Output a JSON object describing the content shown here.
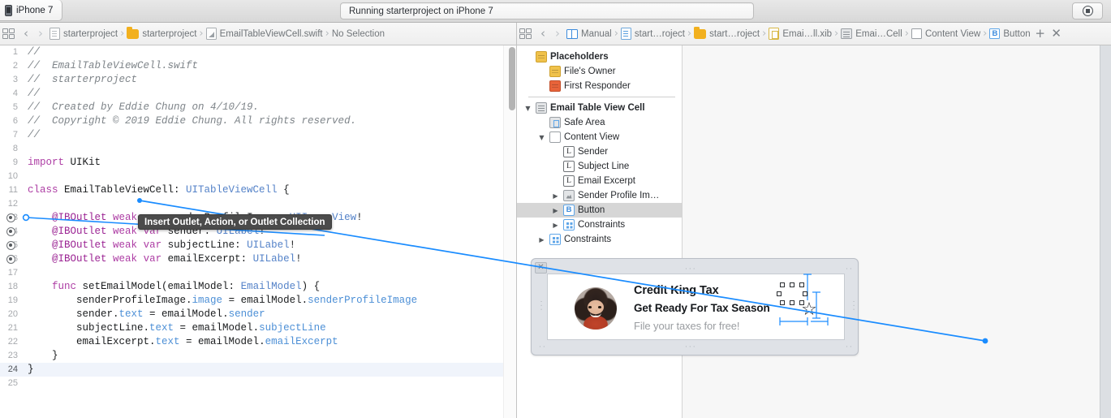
{
  "toolbar": {
    "scheme_tab": "iPhone 7",
    "device_icon": "iphone-icon",
    "activity_status": "Running starterproject on iPhone 7",
    "stop_button_label": "",
    "stop_icon": "stop-icon"
  },
  "left_jumpbar": {
    "related_items_icon": "related-items-icon",
    "back_arrow": "‹",
    "forward_arrow": "›",
    "crumbs": [
      {
        "label": "starterproject",
        "icon": "project-file-icon"
      },
      {
        "label": "starterproject",
        "icon": "folder-icon"
      },
      {
        "label": "EmailTableViewCell.swift",
        "icon": "swift-file-icon"
      },
      {
        "label": "No Selection",
        "icon": "none"
      }
    ],
    "separator": "›"
  },
  "right_jumpbar": {
    "related_items_icon": "related-items-icon",
    "back_arrow": "‹",
    "forward_arrow": "›",
    "crumbs": [
      {
        "label": "Manual",
        "icon": "assistant-manual-icon"
      },
      {
        "label": "start…roject",
        "icon": "project-doc-icon"
      },
      {
        "label": "start…roject",
        "icon": "folder-icon"
      },
      {
        "label": "Emai…ll.xib",
        "icon": "xib-file-icon"
      },
      {
        "label": "Emai…Cell",
        "icon": "table-view-cell-icon"
      },
      {
        "label": "Content View",
        "icon": "view-icon"
      },
      {
        "label": "Button",
        "icon": "button-icon"
      }
    ],
    "separator": "›",
    "add_editor": "+",
    "close_editor": "✕"
  },
  "editor": {
    "tooltip": "Insert Outlet, Action, or Outlet Collection",
    "current_line": 24,
    "lines": [
      {
        "n": "1",
        "gutter": "",
        "tokens": [
          {
            "t": "//",
            "c": "cmt"
          }
        ]
      },
      {
        "n": "2",
        "gutter": "",
        "tokens": [
          {
            "t": "//  EmailTableViewCell.swift",
            "c": "cmt"
          }
        ]
      },
      {
        "n": "3",
        "gutter": "",
        "tokens": [
          {
            "t": "//  starterproject",
            "c": "cmt"
          }
        ]
      },
      {
        "n": "4",
        "gutter": "",
        "tokens": [
          {
            "t": "//",
            "c": "cmt"
          }
        ]
      },
      {
        "n": "5",
        "gutter": "",
        "tokens": [
          {
            "t": "//  Created by Eddie Chung on 4/10/19.",
            "c": "cmt"
          }
        ]
      },
      {
        "n": "6",
        "gutter": "",
        "tokens": [
          {
            "t": "//  Copyright © 2019 Eddie Chung. All rights reserved.",
            "c": "cmt"
          }
        ]
      },
      {
        "n": "7",
        "gutter": "",
        "tokens": [
          {
            "t": "//",
            "c": "cmt"
          }
        ]
      },
      {
        "n": "8",
        "gutter": "",
        "tokens": []
      },
      {
        "n": "9",
        "gutter": "",
        "tokens": [
          {
            "t": "import",
            "c": "kw"
          },
          {
            "t": " UIKit",
            "c": "plain"
          }
        ]
      },
      {
        "n": "10",
        "gutter": "",
        "tokens": []
      },
      {
        "n": "11",
        "gutter": "",
        "tokens": [
          {
            "t": "class",
            "c": "kw"
          },
          {
            "t": " EmailTableViewCell: ",
            "c": "plain"
          },
          {
            "t": "UITableViewCell",
            "c": "typ"
          },
          {
            "t": " {",
            "c": "plain"
          }
        ]
      },
      {
        "n": "12",
        "gutter": "",
        "tokens": []
      },
      {
        "n": "13",
        "gutter": "outlet",
        "tokens": [
          {
            "t": "    @IBOutlet",
            "c": "attr"
          },
          {
            "t": " ",
            "c": "plain"
          },
          {
            "t": "weak",
            "c": "kw"
          },
          {
            "t": " ",
            "c": "plain"
          },
          {
            "t": "var",
            "c": "kw"
          },
          {
            "t": " senderProfileImage: ",
            "c": "plain"
          },
          {
            "t": "UIImageView",
            "c": "typ"
          },
          {
            "t": "!",
            "c": "plain"
          }
        ]
      },
      {
        "n": "14",
        "gutter": "outlet",
        "tokens": [
          {
            "t": "    @IBOutlet",
            "c": "attr"
          },
          {
            "t": " ",
            "c": "plain"
          },
          {
            "t": "weak",
            "c": "kw"
          },
          {
            "t": " ",
            "c": "plain"
          },
          {
            "t": "var",
            "c": "kw"
          },
          {
            "t": " sender: ",
            "c": "plain"
          },
          {
            "t": "UILabel",
            "c": "typ"
          },
          {
            "t": "!",
            "c": "plain"
          }
        ]
      },
      {
        "n": "15",
        "gutter": "outlet",
        "tokens": [
          {
            "t": "    @IBOutlet",
            "c": "attr"
          },
          {
            "t": " ",
            "c": "plain"
          },
          {
            "t": "weak",
            "c": "kw"
          },
          {
            "t": " ",
            "c": "plain"
          },
          {
            "t": "var",
            "c": "kw"
          },
          {
            "t": " subjectLine: ",
            "c": "plain"
          },
          {
            "t": "UILabel",
            "c": "typ"
          },
          {
            "t": "!",
            "c": "plain"
          }
        ]
      },
      {
        "n": "16",
        "gutter": "outlet",
        "tokens": [
          {
            "t": "    @IBOutlet",
            "c": "attr"
          },
          {
            "t": " ",
            "c": "plain"
          },
          {
            "t": "weak",
            "c": "kw"
          },
          {
            "t": " ",
            "c": "plain"
          },
          {
            "t": "var",
            "c": "kw"
          },
          {
            "t": " emailExcerpt: ",
            "c": "plain"
          },
          {
            "t": "UILabel",
            "c": "typ"
          },
          {
            "t": "!",
            "c": "plain"
          }
        ]
      },
      {
        "n": "17",
        "gutter": "",
        "tokens": []
      },
      {
        "n": "18",
        "gutter": "",
        "tokens": [
          {
            "t": "    ",
            "c": "plain"
          },
          {
            "t": "func",
            "c": "kw"
          },
          {
            "t": " setEmailModel(emailModel: ",
            "c": "plain"
          },
          {
            "t": "EmailModel",
            "c": "typ"
          },
          {
            "t": ") {",
            "c": "plain"
          }
        ]
      },
      {
        "n": "19",
        "gutter": "",
        "tokens": [
          {
            "t": "        senderProfileImage.",
            "c": "plain"
          },
          {
            "t": "image",
            "c": "prop"
          },
          {
            "t": " = emailModel.",
            "c": "plain"
          },
          {
            "t": "senderProfileImage",
            "c": "prop"
          }
        ]
      },
      {
        "n": "20",
        "gutter": "",
        "tokens": [
          {
            "t": "        sender.",
            "c": "plain"
          },
          {
            "t": "text",
            "c": "prop"
          },
          {
            "t": " = emailModel.",
            "c": "plain"
          },
          {
            "t": "sender",
            "c": "prop"
          }
        ]
      },
      {
        "n": "21",
        "gutter": "",
        "tokens": [
          {
            "t": "        subjectLine.",
            "c": "plain"
          },
          {
            "t": "text",
            "c": "prop"
          },
          {
            "t": " = emailModel.",
            "c": "plain"
          },
          {
            "t": "subjectLine",
            "c": "prop"
          }
        ]
      },
      {
        "n": "22",
        "gutter": "",
        "tokens": [
          {
            "t": "        emailExcerpt.",
            "c": "plain"
          },
          {
            "t": "text",
            "c": "prop"
          },
          {
            "t": " = emailModel.",
            "c": "plain"
          },
          {
            "t": "emailExcerpt",
            "c": "prop"
          }
        ]
      },
      {
        "n": "23",
        "gutter": "",
        "tokens": [
          {
            "t": "    }",
            "c": "plain"
          }
        ]
      },
      {
        "n": "24",
        "gutter": "",
        "tokens": [
          {
            "t": "}",
            "c": "plain"
          }
        ]
      },
      {
        "n": "25",
        "gutter": "",
        "tokens": []
      }
    ]
  },
  "outline": {
    "placeholders_header": "Placeholders",
    "rows": [
      {
        "label": "Placeholders",
        "icon": "placeholders-cube-icon",
        "indent": 0,
        "twisty": "none",
        "bold": true,
        "selected": false
      },
      {
        "label": "File's Owner",
        "icon": "files-owner-cube-icon",
        "indent": 1,
        "twisty": "none",
        "bold": false,
        "selected": false
      },
      {
        "label": "First Responder",
        "icon": "first-responder-cube-icon",
        "indent": 1,
        "twisty": "none",
        "bold": false,
        "selected": false
      },
      {
        "label": "Email Table View Cell",
        "icon": "table-view-cell-icon",
        "indent": 0,
        "twisty": "open",
        "bold": true,
        "selected": false
      },
      {
        "label": "Safe Area",
        "icon": "safe-area-icon",
        "indent": 1,
        "twisty": "none",
        "bold": false,
        "selected": false
      },
      {
        "label": "Content View",
        "icon": "view-icon",
        "indent": 1,
        "twisty": "open",
        "bold": false,
        "selected": false
      },
      {
        "label": "Sender",
        "icon": "label-icon",
        "indent": 2,
        "twisty": "none",
        "bold": false,
        "selected": false
      },
      {
        "label": "Subject Line",
        "icon": "label-icon",
        "indent": 2,
        "twisty": "none",
        "bold": false,
        "selected": false
      },
      {
        "label": "Email Excerpt",
        "icon": "label-icon",
        "indent": 2,
        "twisty": "none",
        "bold": false,
        "selected": false
      },
      {
        "label": "Sender Profile Im…",
        "icon": "image-view-icon",
        "indent": 2,
        "twisty": "closed",
        "bold": false,
        "selected": false
      },
      {
        "label": "Button",
        "icon": "button-icon",
        "indent": 2,
        "twisty": "closed",
        "bold": false,
        "selected": true
      },
      {
        "label": "Constraints",
        "icon": "constraints-icon",
        "indent": 2,
        "twisty": "closed",
        "bold": false,
        "selected": false
      },
      {
        "label": "Constraints",
        "icon": "constraints-icon",
        "indent": 1,
        "twisty": "closed",
        "bold": false,
        "selected": false
      }
    ]
  },
  "canvas": {
    "close_scene_icon": "close-icon",
    "cell": {
      "avatar_alt": "sender-profile-photo",
      "sender": "Credit King Tax",
      "subject_line": "Get Ready For Tax Season",
      "email_excerpt": "File your taxes for free!",
      "button_glyph": "☆",
      "button_name": "star-button"
    }
  },
  "colors": {
    "accent_blue": "#1a8cff",
    "selection_gray": "#d6d6d6",
    "keyword_magenta": "#ad3da4",
    "type_blue": "#5482c8",
    "comment_gray": "#7e8489",
    "tooltip_bg": "#4b4b4b",
    "folder_yellow": "#f2b01e"
  }
}
